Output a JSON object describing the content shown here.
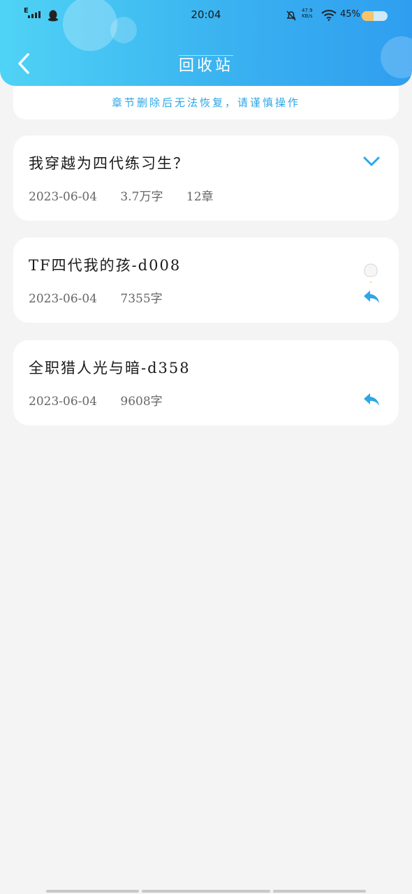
{
  "status_bar": {
    "network": "E",
    "time": "20:04",
    "speed_value": "47.9",
    "speed_unit": "KB/s",
    "battery_percent": "45%",
    "battery_level": 0.45
  },
  "header": {
    "title": "回收站"
  },
  "notice": {
    "text": "章节删除后无法恢复，请谨慎操作"
  },
  "books": [
    {
      "name": "我穿越为四代练习生？",
      "date": "2023-06-04",
      "words": "3.7万字",
      "chapters": "12章",
      "action": "expand"
    },
    {
      "name": "TF四代我的孩-d008",
      "date": "2023-06-04",
      "words": "7355字",
      "chapters": "",
      "action": "restore"
    },
    {
      "name": "全职猎人光与暗-d358",
      "date": "2023-06-04",
      "words": "9608字",
      "chapters": "",
      "action": "restore"
    }
  ],
  "colors": {
    "header_start": "#4fd3f5",
    "header_end": "#2f9ef0",
    "accent": "#2ea6e6",
    "background": "#f4f4f4"
  }
}
